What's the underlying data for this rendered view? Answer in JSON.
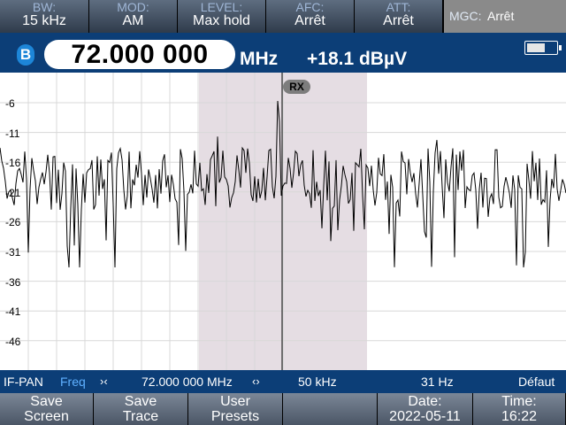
{
  "topbar": {
    "bw": {
      "label": "BW:",
      "value": "15 kHz"
    },
    "mod": {
      "label": "MOD:",
      "value": "AM"
    },
    "level": {
      "label": "LEVEL:",
      "value": "Max hold"
    },
    "afc": {
      "label": "AFC:",
      "value": "Arrêt"
    },
    "att": {
      "label": "ATT:",
      "value": "Arrêt"
    },
    "mgc": {
      "label": "MGC:",
      "value": "Arrêt"
    }
  },
  "receiver": {
    "badge": "B",
    "frequency": "72.000 000",
    "unit": "MHz",
    "level": "+18.1 dBµV"
  },
  "plot": {
    "y_labels": [
      "-6",
      "-11",
      "-16",
      "-21",
      "-26",
      "-31",
      "-36",
      "-41",
      "-46"
    ],
    "marker_label": "RX",
    "colors": {
      "background": "#ffffff",
      "grid": "#d8d8d8",
      "band": "#e5dde3",
      "trace": "#000000"
    }
  },
  "infobar": {
    "mode": "IF-PAN",
    "freq_label": "Freq",
    "center_frequency": "72.000 000 MHz",
    "span": "50 kHz",
    "rbw": "31 Hz",
    "preset": "Défaut",
    "icon_center": "center-frequency-icon",
    "icon_span": "span-icon"
  },
  "bottombar": {
    "save_screen": [
      "Save",
      "Screen"
    ],
    "save_trace": [
      "Save",
      "Trace"
    ],
    "user_presets": [
      "User",
      "Presets"
    ],
    "date": [
      "Date:",
      "2022-05-11"
    ],
    "time": [
      "Time:",
      "16:22"
    ]
  },
  "colors": {
    "header_blue": "#0c3e77",
    "accent_blue": "#5fb0ff",
    "button_gray": "#6b7686"
  }
}
